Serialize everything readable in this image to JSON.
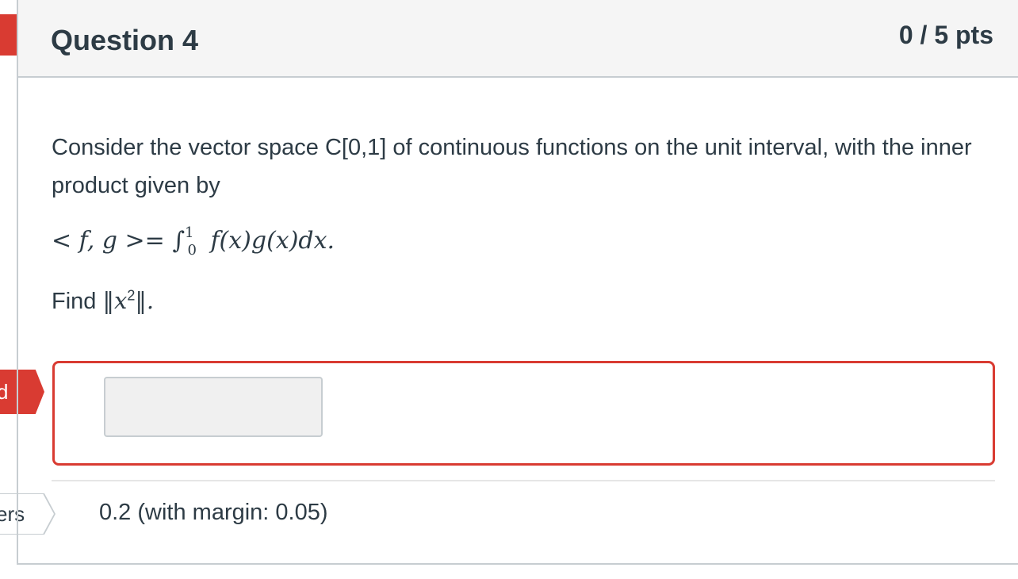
{
  "side_flags": {
    "top_label": "",
    "incorrect_label": "d",
    "answers_label": "ers"
  },
  "question": {
    "title": "Question 4",
    "points": "0 / 5 pts",
    "intro": "Consider the vector space C[0,1] of continuous functions on the unit interval, with the inner product given by",
    "formula": {
      "lhs": "< f, g >=",
      "integral": "∫",
      "upper": "1",
      "lower": "0",
      "rhs": "f(x)g(x)dx."
    },
    "find": {
      "prefix": "Find",
      "open": "‖",
      "var": "x",
      "exp": "2",
      "close": "‖."
    }
  },
  "answer": {
    "input_value": "",
    "correct_answer": "0.2 (with margin: 0.05)"
  },
  "colors": {
    "incorrect": "#d93b32",
    "header_bg": "#f5f5f5",
    "border": "#c7cdd1",
    "text": "#2d3b45"
  }
}
